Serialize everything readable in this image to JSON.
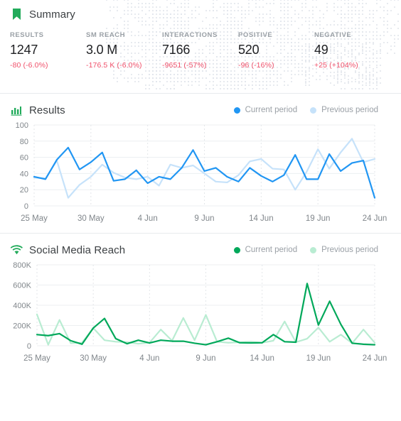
{
  "summary": {
    "icon": "bookmark-icon",
    "icon_color": "#22ab5b",
    "title": "Summary",
    "metrics": [
      {
        "label": "RESULTS",
        "value": "1247",
        "delta": "-80 (-6.0%)"
      },
      {
        "label": "SM REACH",
        "value": "3.0 M",
        "delta": "-176.5 K (-6.0%)"
      },
      {
        "label": "INTERACTIONS",
        "value": "7166",
        "delta": "-9651 (-57%)"
      },
      {
        "label": "POSITIVE",
        "value": "520",
        "delta": "-96 (-16%)"
      },
      {
        "label": "NEGATIVE",
        "value": "49",
        "delta": "+25 (+104%)"
      }
    ],
    "delta_color": "#f0506a"
  },
  "results_card": {
    "icon": "bar-chart-icon",
    "icon_color": "#22ab5b",
    "title": "Results",
    "legend": [
      {
        "label": "Current period",
        "color": "#2196f3"
      },
      {
        "label": "Previous period",
        "color": "#c6e2fa"
      }
    ]
  },
  "reach_card": {
    "icon": "wifi-icon",
    "icon_color": "#22ab5b",
    "title": "Social Media Reach",
    "legend": [
      {
        "label": "Current period",
        "color": "#00a85a"
      },
      {
        "label": "Previous period",
        "color": "#b9ecd2"
      }
    ]
  },
  "chart_data": [
    {
      "id": "results",
      "type": "line",
      "title": "Results",
      "xlabel": "",
      "ylabel": "",
      "ylim": [
        0,
        100
      ],
      "yticks": [
        0,
        20,
        40,
        60,
        80,
        100
      ],
      "ytick_labels": [
        "0",
        "20",
        "40",
        "60",
        "80",
        "100"
      ],
      "grid": true,
      "legend_position": "top-right",
      "x": [
        "25 May",
        "26 May",
        "27 May",
        "28 May",
        "29 May",
        "30 May",
        "31 May",
        "1 Jun",
        "2 Jun",
        "3 Jun",
        "4 Jun",
        "5 Jun",
        "6 Jun",
        "7 Jun",
        "8 Jun",
        "9 Jun",
        "10 Jun",
        "11 Jun",
        "12 Jun",
        "13 Jun",
        "14 Jun",
        "15 Jun",
        "16 Jun",
        "17 Jun",
        "18 Jun",
        "19 Jun",
        "20 Jun",
        "21 Jun",
        "22 Jun",
        "23 Jun",
        "24 Jun"
      ],
      "xtick_labels": [
        "25 May",
        "30 May",
        "4 Jun",
        "9 Jun",
        "14 Jun",
        "19 Jun",
        "24 Jun"
      ],
      "xtick_indices": [
        0,
        5,
        10,
        15,
        20,
        25,
        30
      ],
      "series": [
        {
          "name": "Current period",
          "color": "#2196f3",
          "values": [
            36,
            33,
            57,
            72,
            45,
            54,
            66,
            31,
            33,
            44,
            28,
            36,
            33,
            47,
            69,
            43,
            47,
            36,
            30,
            47,
            37,
            30,
            38,
            63,
            33,
            33,
            64,
            43,
            53,
            56,
            10
          ]
        },
        {
          "name": "Previous period",
          "color": "#c6e2fa",
          "values": [
            35,
            34,
            56,
            10,
            26,
            36,
            51,
            41,
            35,
            33,
            36,
            25,
            51,
            47,
            50,
            40,
            30,
            29,
            38,
            55,
            58,
            46,
            45,
            20,
            42,
            70,
            46,
            66,
            83,
            54,
            58
          ]
        }
      ]
    },
    {
      "id": "social_media_reach",
      "type": "line",
      "title": "Social Media Reach",
      "xlabel": "",
      "ylabel": "",
      "ylim": [
        0,
        800000
      ],
      "yticks": [
        0,
        200000,
        400000,
        600000,
        800000
      ],
      "ytick_labels": [
        "0",
        "200K",
        "400K",
        "600K",
        "800K"
      ],
      "grid": true,
      "legend_position": "top-right",
      "x": [
        "25 May",
        "26 May",
        "27 May",
        "28 May",
        "29 May",
        "30 May",
        "31 May",
        "1 Jun",
        "2 Jun",
        "3 Jun",
        "4 Jun",
        "5 Jun",
        "6 Jun",
        "7 Jun",
        "8 Jun",
        "9 Jun",
        "10 Jun",
        "11 Jun",
        "12 Jun",
        "13 Jun",
        "14 Jun",
        "15 Jun",
        "16 Jun",
        "17 Jun",
        "18 Jun",
        "19 Jun",
        "20 Jun",
        "21 Jun",
        "22 Jun",
        "23 Jun",
        "24 Jun"
      ],
      "xtick_labels": [
        "25 May",
        "30 May",
        "4 Jun",
        "9 Jun",
        "14 Jun",
        "19 Jun",
        "24 Jun"
      ],
      "xtick_indices": [
        0,
        5,
        10,
        15,
        20,
        25,
        30
      ],
      "series": [
        {
          "name": "Current period",
          "color": "#00a85a",
          "values": [
            110000,
            100000,
            120000,
            50000,
            15000,
            175000,
            270000,
            70000,
            20000,
            55000,
            28000,
            55000,
            45000,
            45000,
            25000,
            10000,
            40000,
            75000,
            30000,
            28000,
            30000,
            110000,
            40000,
            35000,
            615000,
            205000,
            440000,
            210000,
            25000,
            15000,
            10000
          ]
        },
        {
          "name": "Previous period",
          "color": "#b9ecd2",
          "values": [
            310000,
            10000,
            255000,
            25000,
            30000,
            175000,
            55000,
            40000,
            35000,
            20000,
            30000,
            160000,
            50000,
            275000,
            55000,
            305000,
            40000,
            30000,
            35000,
            40000,
            30000,
            50000,
            240000,
            35000,
            70000,
            180000,
            40000,
            110000,
            25000,
            160000,
            30000
          ]
        }
      ]
    }
  ]
}
